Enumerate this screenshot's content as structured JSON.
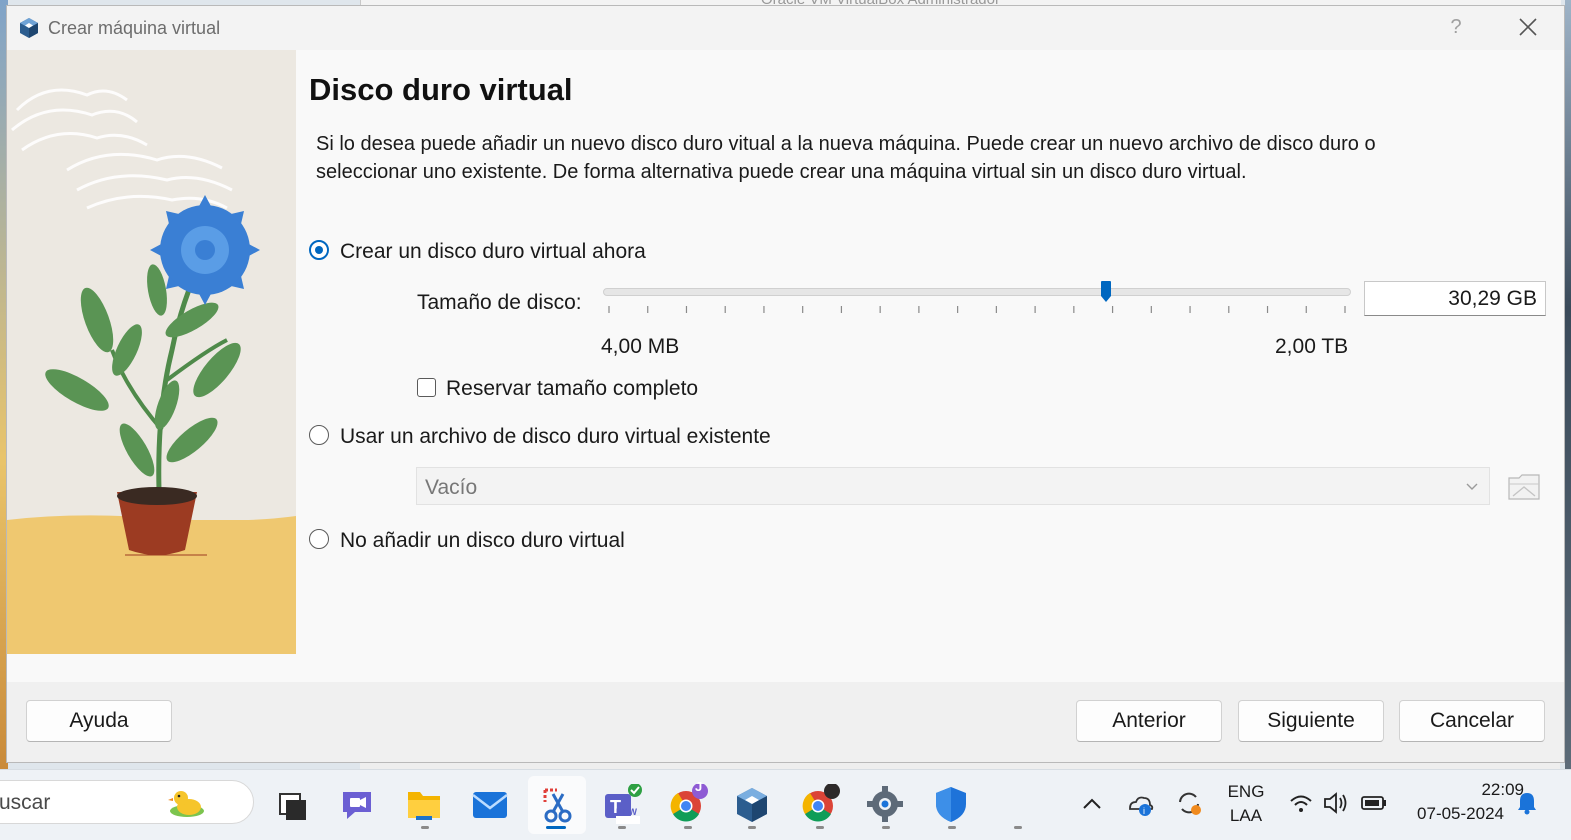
{
  "background": {
    "window_title": "Oracle VM VirtualBox Administrador"
  },
  "dialog": {
    "title": "Crear máquina virtual",
    "app_icon": "virtualbox-cube-icon",
    "help_label": "?",
    "heading": "Disco duro virtual",
    "description": "Si lo desea puede añadir un nuevo disco duro vitual a la nueva máquina. Puede crear un nuevo archivo de disco duro o seleccionar uno existente. De forma alternativa puede crear una máquina virtual sin un disco duro virtual.",
    "options": {
      "create_now": {
        "label": "Crear un disco duro virtual ahora",
        "checked": true
      },
      "use_existing": {
        "label": "Usar un archivo de disco duro virtual existente",
        "checked": false
      },
      "no_disk": {
        "label": "No añadir un disco duro virtual",
        "checked": false
      }
    },
    "disk_size": {
      "label": "Tamaño de disco:",
      "value": "30,29 GB",
      "min_label": "4,00 MB",
      "max_label": "2,00 TB",
      "slider_fraction": 0.675,
      "tick_count": 20
    },
    "preallocate": {
      "label": "Reservar tamaño completo",
      "checked": false
    },
    "existing_file": {
      "value": "Vacío",
      "disabled": true
    },
    "buttons": {
      "help": "Ayuda",
      "back": "Anterior",
      "next": "Siguiente",
      "cancel": "Cancelar"
    }
  },
  "taskbar": {
    "search_text": "uscar",
    "language": "ENG",
    "layout": "LAA",
    "time": "22:09",
    "date": "07-05-2024",
    "apps": [
      "task-view-icon",
      "chat-icon",
      "file-explorer-icon",
      "mail-icon",
      "snipping-tool-icon",
      "teams-icon",
      "chrome-icon",
      "virtualbox-icon",
      "chrome-icon",
      "settings-icon",
      "windows-security-icon"
    ],
    "teams_badge": "NEW",
    "chrome_profile_badge": "J",
    "colors": {
      "accent": "#0067c0"
    }
  }
}
